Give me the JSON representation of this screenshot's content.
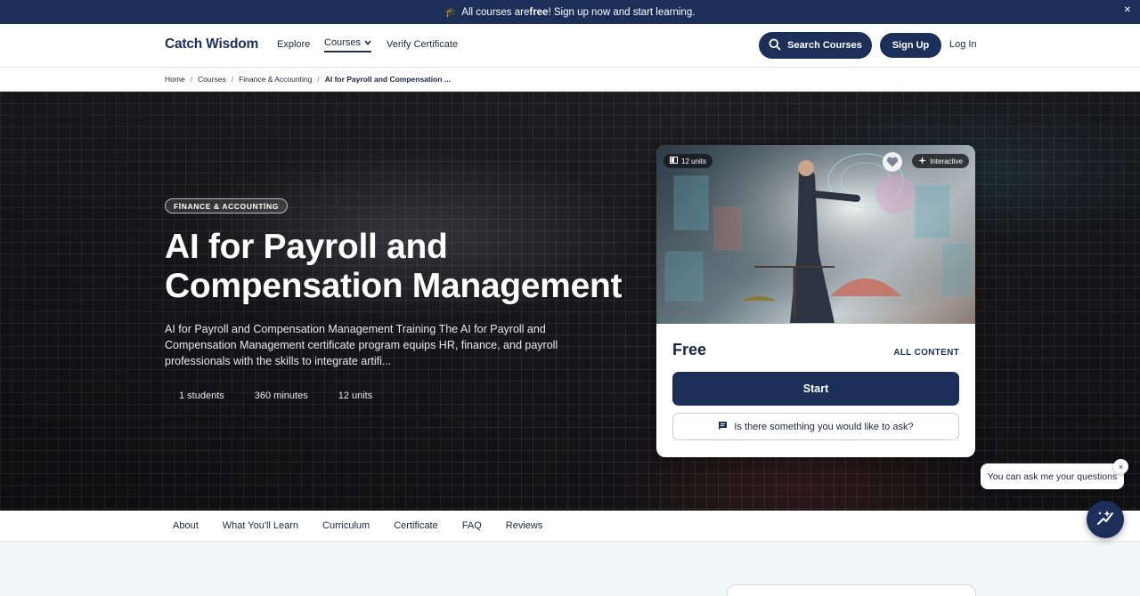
{
  "announcement": {
    "prefix": "All courses are ",
    "bold": "free",
    "suffix": "! Sign up now and start learning.",
    "icon": "graduation-cap-icon"
  },
  "header": {
    "logo": "Catch Wisdom",
    "nav": {
      "explore": "Explore",
      "courses": "Courses",
      "verify": "Verify Certificate"
    },
    "search_label": "Search Courses",
    "signup_label": "Sign Up",
    "login_label": "Log In"
  },
  "breadcrumb": {
    "items": [
      "Home",
      "Courses",
      "Finance & Accounting"
    ],
    "current": "AI for Payroll and Compensation ..."
  },
  "hero": {
    "tag": "FİNANCE & ACCOUNTİNG",
    "title": "AI for Payroll and Compensation Management",
    "description": "AI for Payroll and Compensation Management Training The AI for Payroll and Compensation Management certificate program equips HR, finance, and payroll professionals with the skills to integrate artifi...",
    "stats": {
      "students": "1 students",
      "minutes": "360 minutes",
      "units": "12 units"
    }
  },
  "card": {
    "units_chip": "12 units",
    "interactive_chip": "Interactive",
    "price": "Free",
    "access": "ALL CONTENT",
    "start_label": "Start",
    "ask_label": "Is there something you would like to ask?"
  },
  "tabs": [
    "About",
    "What You'll Learn",
    "Curriculum",
    "Certificate",
    "FAQ",
    "Reviews"
  ],
  "chat": {
    "bubble": "You can ask me your questions",
    "close": "×"
  },
  "colors": {
    "brand": "#1c2f58",
    "announce_bg": "#1c2f58",
    "hero_bg": "#1b1b1e"
  }
}
